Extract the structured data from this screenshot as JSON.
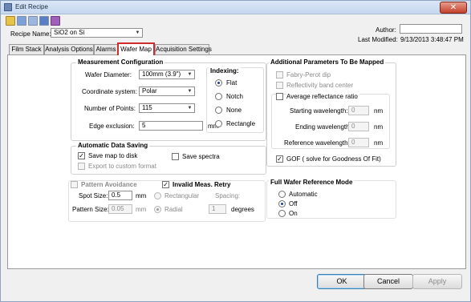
{
  "window": {
    "title": "Edit Recipe",
    "close_glyph": "✕"
  },
  "toolbar": {
    "icons": [
      "open-folder-icon",
      "save-icon",
      "save-as-icon",
      "export-icon",
      "settings-icon"
    ]
  },
  "header": {
    "recipe_name_label": "Recipe Name:",
    "recipe_name_value": "SiO2 on Si",
    "author_label": "Author:",
    "author_value": "",
    "last_modified_label": "Last Modified:",
    "last_modified_value": "9/13/2013 3:48:47 PM"
  },
  "tabs": [
    {
      "label": "Film Stack"
    },
    {
      "label": "Analysis Options"
    },
    {
      "label": "Alarms"
    },
    {
      "label": "Wafer Map",
      "active": true
    },
    {
      "label": "Acquisition Settings"
    }
  ],
  "measurement": {
    "title": "Measurement Configuration",
    "diameter_label": "Wafer Diameter:",
    "diameter_value": "100mm (3.9\")",
    "coord_label": "Coordinate system:",
    "coord_value": "Polar",
    "points_label": "Number of Points:",
    "points_value": "115",
    "edge_label": "Edge exclusion:",
    "edge_value": "5",
    "edge_unit": "mm"
  },
  "indexing": {
    "title": "Indexing:",
    "options": [
      "Flat",
      "Notch",
      "None",
      "Rectangle"
    ],
    "selected": "Flat"
  },
  "data_saving": {
    "title": "Automatic Data Saving",
    "save_map": "Save map to disk",
    "save_map_checked": true,
    "export_custom": "Export to custom format",
    "save_spectra": "Save spectra"
  },
  "pattern": {
    "avoidance_label": "Pattern Avoidance",
    "invalid_retry_label": "Invalid Meas. Retry",
    "invalid_retry_checked": true,
    "spot_size_label": "Spot Size:",
    "spot_size_value": "0.5",
    "spot_size_unit": "mm",
    "pattern_size_label": "Pattern Size:",
    "pattern_size_value": "0.05",
    "pattern_size_unit": "mm",
    "rectangular_label": "Rectangular",
    "radial_label": "Radial",
    "spacing_label": "Spacing:",
    "spacing_value": "1",
    "spacing_unit": "degrees"
  },
  "additional": {
    "title": "Additional Parameters To Be Mapped",
    "fabry_perot": "Fabry-Perot dip",
    "reflectivity": "Reflectivity band center",
    "avg_reflectance": "Average reflectance ratio",
    "start_wl_label": "Starting wavelength:",
    "start_wl_value": "0",
    "end_wl_label": "Ending wavelength:",
    "end_wl_value": "0",
    "ref_wl_label": "Reference wavelength:",
    "ref_wl_value": "0",
    "wl_unit": "nm",
    "gof_label": "GOF ( solve for Goodness Of Fit)",
    "gof_checked": true
  },
  "reference": {
    "title": "Full Wafer Reference Mode",
    "options": [
      "Automatic",
      "Off",
      "On"
    ],
    "selected": "Off"
  },
  "buttons": {
    "ok": "OK",
    "cancel": "Cancel",
    "apply": "Apply"
  },
  "colors": {
    "active_tab_outline": "#d12c2c",
    "title_bar": "#c6d7ee"
  }
}
